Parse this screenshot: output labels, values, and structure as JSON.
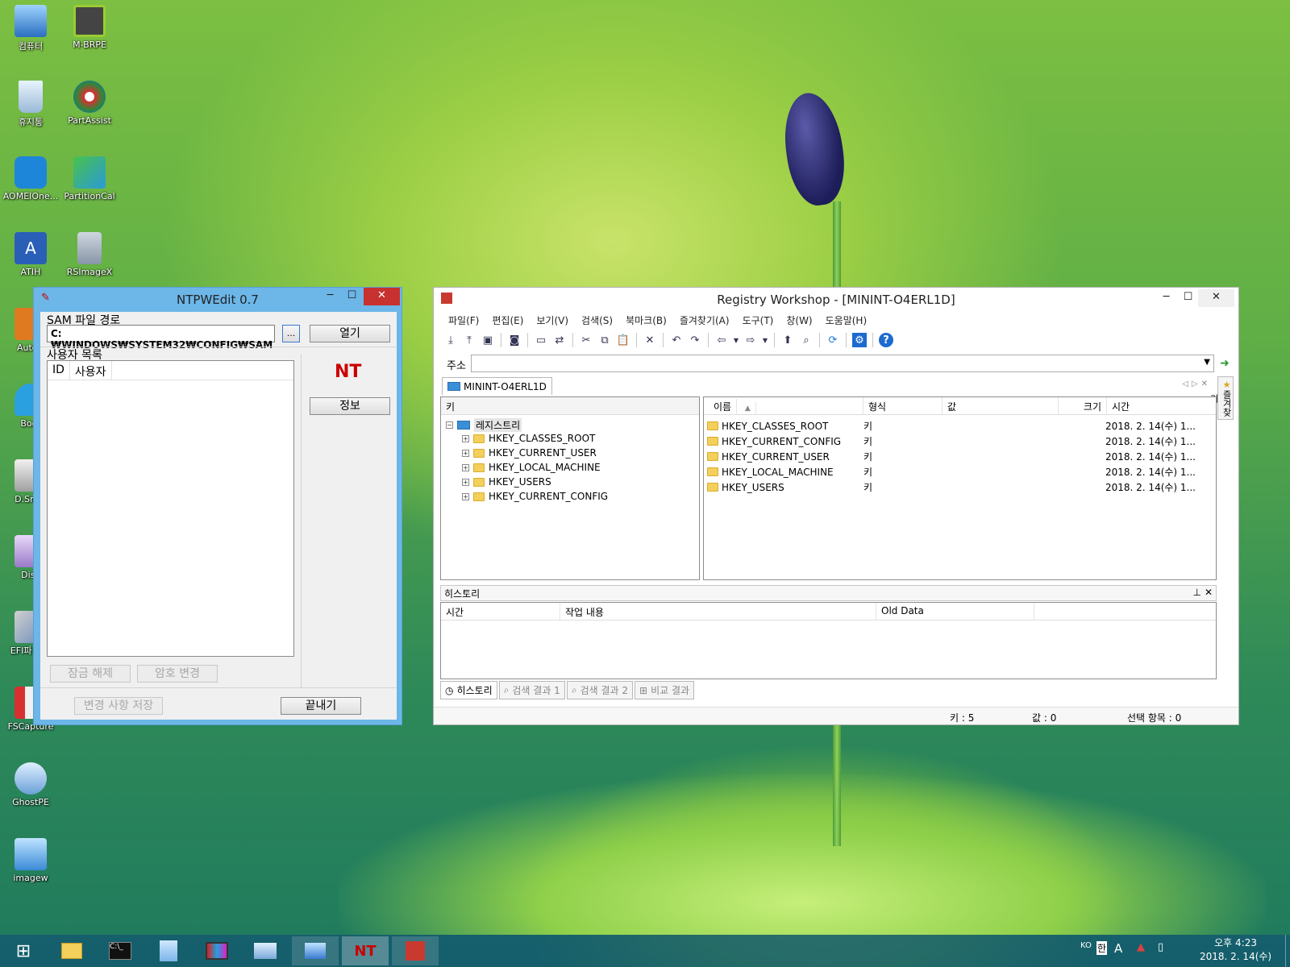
{
  "desktop": {
    "icons": [
      {
        "label": "컴퓨터"
      },
      {
        "label": "M-BRPE"
      },
      {
        "label": "휴지통"
      },
      {
        "label": "PartAssist"
      },
      {
        "label": "AOMEIOne..."
      },
      {
        "label": "PartitionCal"
      },
      {
        "label": "ATIH"
      },
      {
        "label": "RSImageX"
      },
      {
        "label": "AutoD"
      },
      {
        "label": "Boot"
      },
      {
        "label": "D.Snap"
      },
      {
        "label": "Disk"
      },
      {
        "label": "EFI파 접근"
      },
      {
        "label": "FSCapture"
      },
      {
        "label": "GhostPE"
      },
      {
        "label": "imagew"
      }
    ]
  },
  "ntpwedit": {
    "title": "NTPWEdit 0.7",
    "sam_label": "SAM 파일 경로",
    "sam_path": "C:₩WINDOWS₩SYSTEM32₩CONFIG₩SAM",
    "browse": "...",
    "open": "열기",
    "user_list_label": "사용자 목록",
    "col_id": "ID",
    "col_user": "사용자",
    "info": "정보",
    "unlock": "잠금 해제",
    "change_pw": "암호 변경",
    "save": "변경 사항 저장",
    "exit": "끝내기",
    "logo": "NT"
  },
  "registry": {
    "title": "Registry Workshop - [MININT-O4ERL1D]",
    "menu": [
      "파일(F)",
      "편집(E)",
      "보기(V)",
      "검색(S)",
      "북마크(B)",
      "즐겨찾기(A)",
      "도구(T)",
      "창(W)",
      "도움말(H)"
    ],
    "address_label": "주소",
    "address_value": "",
    "doc_tab": "MININT-O4ERL1D",
    "side_strip": "즐겨찾기",
    "tree_header": "키",
    "tree_root": "레지스트리",
    "tree_items": [
      "HKEY_CLASSES_ROOT",
      "HKEY_CURRENT_USER",
      "HKEY_LOCAL_MACHINE",
      "HKEY_USERS",
      "HKEY_CURRENT_CONFIG"
    ],
    "list_headers": {
      "name": "이름",
      "type": "형식",
      "value": "값",
      "size": "크기",
      "time": "시간"
    },
    "list_rows": [
      {
        "name": "HKEY_CLASSES_ROOT",
        "type": "키",
        "time": "2018. 2. 14(수) 1..."
      },
      {
        "name": "HKEY_CURRENT_CONFIG",
        "type": "키",
        "time": "2018. 2. 14(수) 1..."
      },
      {
        "name": "HKEY_CURRENT_USER",
        "type": "키",
        "time": "2018. 2. 14(수) 1..."
      },
      {
        "name": "HKEY_LOCAL_MACHINE",
        "type": "키",
        "time": "2018. 2. 14(수) 1..."
      },
      {
        "name": "HKEY_USERS",
        "type": "키",
        "time": "2018. 2. 14(수) 1..."
      }
    ],
    "history_title": "히스토리",
    "history_cols": {
      "time": "시간",
      "action": "작업 내용",
      "old": "Old Data"
    },
    "bottom_tabs": [
      "히스토리",
      "검색 결과 1",
      "검색 결과 2",
      "비교 결과"
    ],
    "status": {
      "keys": "키 : 5",
      "values": "값 : 0",
      "selected": "선택 항목 : 0"
    }
  },
  "taskbar": {
    "tray": {
      "lang": "KO",
      "ime": "한",
      "mode": "A"
    },
    "clock_time": "오후 4:23",
    "clock_date": "2018. 2. 14(수)"
  },
  "colors": {
    "ntpw_frame": "#6cb6e8",
    "close_button": "#c7312f",
    "taskbar": "#145a6e"
  }
}
